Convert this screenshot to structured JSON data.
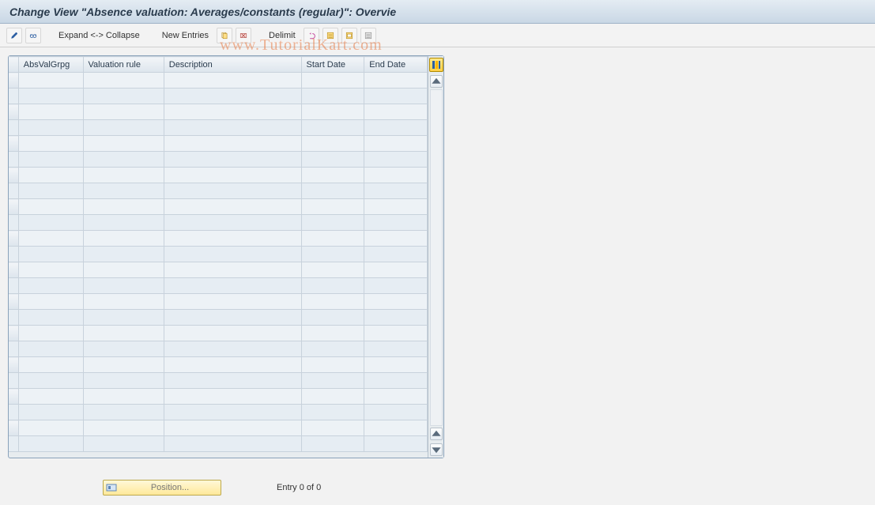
{
  "title": "Change View \"Absence valuation: Averages/constants (regular)\": Overvie",
  "toolbar": {
    "expand_collapse_label": "Expand <-> Collapse",
    "new_entries_label": "New Entries",
    "delimit_label": "Delimit"
  },
  "columns": {
    "absvalgrpg": "AbsValGrpg",
    "valuation_rule": "Valuation rule",
    "description": "Description",
    "start_date": "Start Date",
    "end_date": "End Date"
  },
  "rows": [
    {
      "absvalgrpg": "",
      "valuation_rule": "",
      "description": "",
      "start_date": "",
      "end_date": ""
    },
    {
      "absvalgrpg": "",
      "valuation_rule": "",
      "description": "",
      "start_date": "",
      "end_date": ""
    },
    {
      "absvalgrpg": "",
      "valuation_rule": "",
      "description": "",
      "start_date": "",
      "end_date": ""
    },
    {
      "absvalgrpg": "",
      "valuation_rule": "",
      "description": "",
      "start_date": "",
      "end_date": ""
    },
    {
      "absvalgrpg": "",
      "valuation_rule": "",
      "description": "",
      "start_date": "",
      "end_date": ""
    },
    {
      "absvalgrpg": "",
      "valuation_rule": "",
      "description": "",
      "start_date": "",
      "end_date": ""
    },
    {
      "absvalgrpg": "",
      "valuation_rule": "",
      "description": "",
      "start_date": "",
      "end_date": ""
    },
    {
      "absvalgrpg": "",
      "valuation_rule": "",
      "description": "",
      "start_date": "",
      "end_date": ""
    },
    {
      "absvalgrpg": "",
      "valuation_rule": "",
      "description": "",
      "start_date": "",
      "end_date": ""
    },
    {
      "absvalgrpg": "",
      "valuation_rule": "",
      "description": "",
      "start_date": "",
      "end_date": ""
    },
    {
      "absvalgrpg": "",
      "valuation_rule": "",
      "description": "",
      "start_date": "",
      "end_date": ""
    },
    {
      "absvalgrpg": "",
      "valuation_rule": "",
      "description": "",
      "start_date": "",
      "end_date": ""
    },
    {
      "absvalgrpg": "",
      "valuation_rule": "",
      "description": "",
      "start_date": "",
      "end_date": ""
    },
    {
      "absvalgrpg": "",
      "valuation_rule": "",
      "description": "",
      "start_date": "",
      "end_date": ""
    },
    {
      "absvalgrpg": "",
      "valuation_rule": "",
      "description": "",
      "start_date": "",
      "end_date": ""
    },
    {
      "absvalgrpg": "",
      "valuation_rule": "",
      "description": "",
      "start_date": "",
      "end_date": ""
    },
    {
      "absvalgrpg": "",
      "valuation_rule": "",
      "description": "",
      "start_date": "",
      "end_date": ""
    },
    {
      "absvalgrpg": "",
      "valuation_rule": "",
      "description": "",
      "start_date": "",
      "end_date": ""
    },
    {
      "absvalgrpg": "",
      "valuation_rule": "",
      "description": "",
      "start_date": "",
      "end_date": ""
    },
    {
      "absvalgrpg": "",
      "valuation_rule": "",
      "description": "",
      "start_date": "",
      "end_date": ""
    },
    {
      "absvalgrpg": "",
      "valuation_rule": "",
      "description": "",
      "start_date": "",
      "end_date": ""
    },
    {
      "absvalgrpg": "",
      "valuation_rule": "",
      "description": "",
      "start_date": "",
      "end_date": ""
    },
    {
      "absvalgrpg": "",
      "valuation_rule": "",
      "description": "",
      "start_date": "",
      "end_date": ""
    },
    {
      "absvalgrpg": "",
      "valuation_rule": "",
      "description": "",
      "start_date": "",
      "end_date": ""
    }
  ],
  "footer": {
    "position_label": "Position...",
    "entry_count_label": "Entry 0 of 0"
  },
  "watermark_text": "www.TutorialKart.com"
}
